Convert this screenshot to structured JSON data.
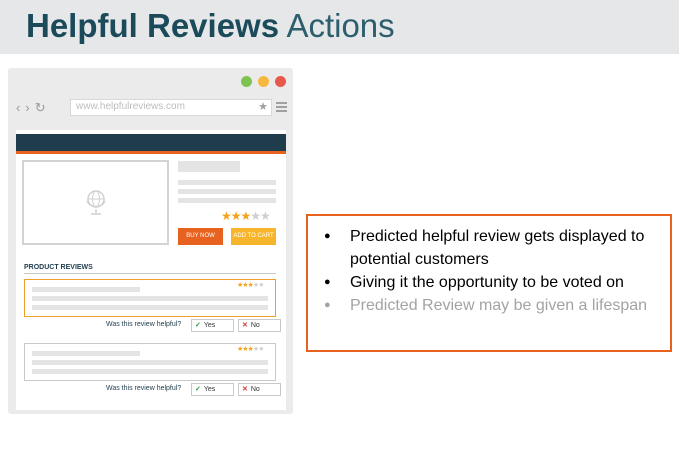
{
  "title": {
    "bold": "Helpful Reviews",
    "light": "Actions"
  },
  "browser": {
    "window_dots": [
      {
        "name": "green",
        "color": "#7ec252"
      },
      {
        "name": "yellow",
        "color": "#f6b83e"
      },
      {
        "name": "red",
        "color": "#e8594b"
      }
    ],
    "nav_icons": [
      "back-arrow-icon",
      "forward-arrow-icon",
      "refresh-icon"
    ],
    "url": "www.helpfulreviews.com",
    "bookmark_icon": "star-icon",
    "menu_icon": "hamburger-menu-icon"
  },
  "product": {
    "image_icon": "globe-icon",
    "rating": {
      "filled": 3,
      "total": 5
    },
    "buy_now": "BUY NOW",
    "add_to_cart": "ADD TO CART"
  },
  "reviews_section": {
    "label": "PRODUCT REVIEWS",
    "reviews": [
      {
        "rating": {
          "filled": 3,
          "total": 5
        },
        "highlighted": true
      },
      {
        "rating": {
          "filled": 3,
          "total": 5
        },
        "highlighted": false
      }
    ],
    "helpful_question": "Was this review helpful?",
    "yes_label": "Yes",
    "no_label": "No"
  },
  "callout": {
    "bullets": [
      {
        "text": "Predicted helpful review gets displayed to potential customers",
        "muted": false
      },
      {
        "text": "Giving it the opportunity to be voted on",
        "muted": false
      },
      {
        "text": "Predicted Review may be given a lifespan",
        "muted": true
      }
    ]
  },
  "colors": {
    "title": "#1b4a5a",
    "accent_orange": "#e8621f",
    "header_navy": "#1e3c4c",
    "star_gold": "#f2a51c",
    "cart_yellow": "#f7b52c"
  }
}
